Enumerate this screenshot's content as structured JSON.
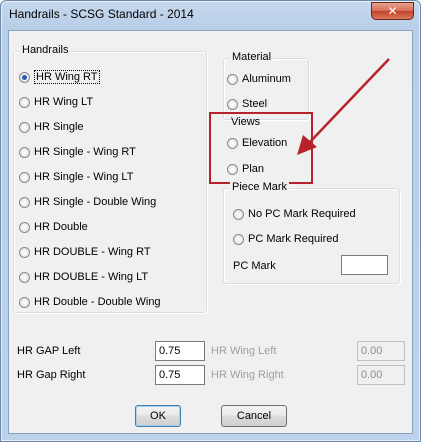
{
  "window": {
    "title": "Handrails - SCSG Standard - 2014",
    "close_label": "✕"
  },
  "handrails": {
    "group_label": "Handrails",
    "options": [
      {
        "label": "HR Wing RT",
        "checked": true
      },
      {
        "label": "HR Wing LT",
        "checked": false
      },
      {
        "label": "HR Single",
        "checked": false
      },
      {
        "label": "HR Single - Wing RT",
        "checked": false
      },
      {
        "label": "HR Single - Wing LT",
        "checked": false
      },
      {
        "label": "HR Single - Double Wing",
        "checked": false
      },
      {
        "label": "HR Double",
        "checked": false
      },
      {
        "label": "HR DOUBLE - Wing RT",
        "checked": false
      },
      {
        "label": "HR DOUBLE - Wing LT",
        "checked": false
      },
      {
        "label": "HR Double - Double Wing",
        "checked": false
      }
    ]
  },
  "material": {
    "group_label": "Material",
    "options": [
      {
        "label": "Aluminum",
        "checked": false
      },
      {
        "label": "Steel",
        "checked": false
      }
    ]
  },
  "views": {
    "group_label": "Views",
    "options": [
      {
        "label": "Elevation",
        "checked": false
      },
      {
        "label": "Plan",
        "checked": false
      }
    ]
  },
  "piece_mark": {
    "group_label": "Piece Mark",
    "options": [
      {
        "label": "No PC Mark Required",
        "checked": false
      },
      {
        "label": "PC Mark Required",
        "checked": false
      }
    ],
    "pc_mark_label": "PC Mark",
    "pc_mark_value": ""
  },
  "gaps": {
    "gap_left_label": "HR GAP Left",
    "gap_left_value": "0.75",
    "gap_right_label": "HR Gap Right",
    "gap_right_value": "0.75",
    "wing_left_label": "HR Wing Left",
    "wing_left_value": "0.00",
    "wing_right_label": "HR Wing Right",
    "wing_right_value": "0.00"
  },
  "buttons": {
    "ok_label": "OK",
    "cancel_label": "Cancel"
  },
  "colors": {
    "annotation": "#b6232a",
    "radio_selected": "#2a5db0"
  }
}
